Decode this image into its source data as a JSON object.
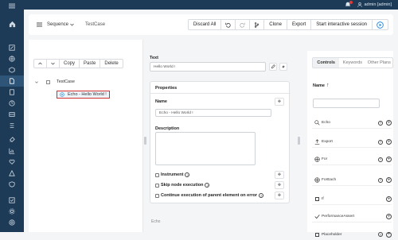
{
  "topbar": {
    "user": "admin [admin]"
  },
  "header": {
    "sequence_label": "Sequence",
    "testcase_title": "TestCase",
    "buttons": [
      "Discard All",
      "Clone",
      "Export",
      "Start interactive session"
    ]
  },
  "tree": {
    "toolbar": [
      "Copy",
      "Paste",
      "Delete"
    ],
    "root": "TestCase",
    "child": "Echo - Hello World !"
  },
  "props": {
    "text_label": "Text",
    "text_value": "Hello World !",
    "properties_title": "Properties",
    "name_label": "Name",
    "name_value": "Echo - Hello World !",
    "description_label": "Description",
    "instrument": "Instrument",
    "skip": "Skip node execution",
    "continue": "Continue execution of parent element on error",
    "footer": "Echo"
  },
  "controls": {
    "tabs": [
      "Controls",
      "Keywords",
      "Other Plans"
    ],
    "sort_label": "Name",
    "items": [
      {
        "name": "Echo",
        "icon": "echo-icon"
      },
      {
        "name": "Export",
        "icon": "export-icon"
      },
      {
        "name": "For",
        "icon": "for-icon"
      },
      {
        "name": "ForEach",
        "icon": "foreach-icon"
      },
      {
        "name": "If",
        "icon": "if-icon"
      },
      {
        "name": "PerformanceAssert",
        "icon": "check-icon"
      },
      {
        "name": "Placeholder",
        "icon": "placeholder-icon"
      }
    ]
  },
  "colors": {
    "nav": "#1d3b57",
    "accent": "#1e88e5",
    "selection": "#d32f2f"
  }
}
